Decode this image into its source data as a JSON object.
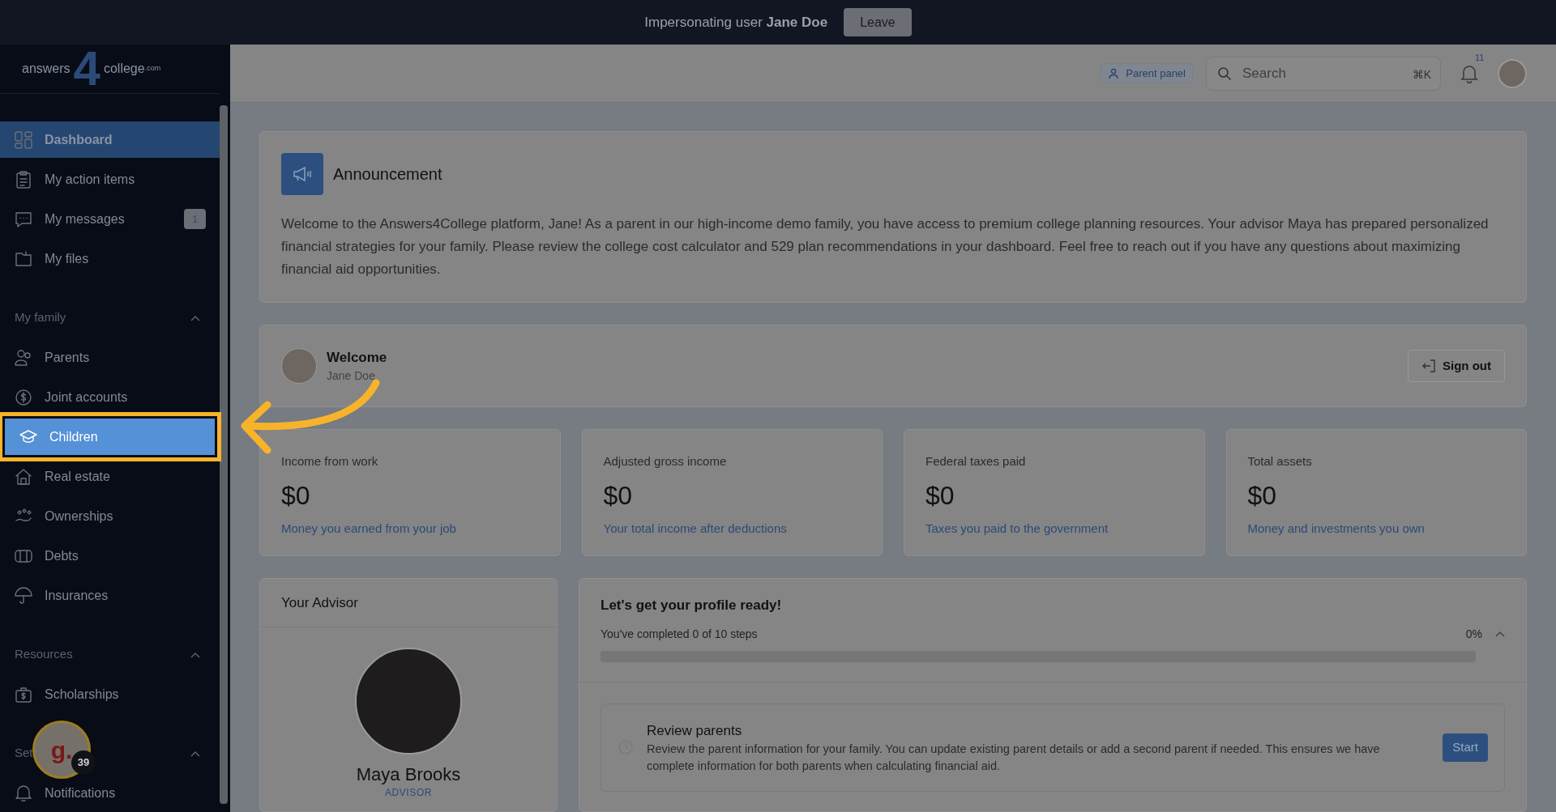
{
  "impersonation_bar": {
    "text": "Impersonating user **Jane Doe**",
    "button": "Leave"
  },
  "logo": {
    "left": "answers",
    "digit": "4",
    "right": "college",
    "suffix": ".com"
  },
  "header": {
    "parent_panel": "Parent panel",
    "search": {
      "placeholder": "Search",
      "shortcut": "⌘K"
    },
    "notifications": "11"
  },
  "sidebar": {
    "items": [
      {
        "label": "Dashboard",
        "selected": true
      },
      {
        "label": "My action items",
        "selected": false
      },
      {
        "label": "My messages",
        "selected": false,
        "badge": "1"
      },
      {
        "label": "My files",
        "selected": false
      }
    ],
    "sections": [
      {
        "title": "My family",
        "expanded": true,
        "items": [
          {
            "label": "Parents",
            "selected": false
          },
          {
            "label": "Joint accounts",
            "selected": false
          },
          {
            "label": "Children",
            "selected": false,
            "highlighted": true
          },
          {
            "label": "Real estate",
            "selected": false
          },
          {
            "label": "Ownerships",
            "selected": false
          },
          {
            "label": "Debts",
            "selected": false
          },
          {
            "label": "Insurances",
            "selected": false
          }
        ]
      },
      {
        "title": "Resources",
        "expanded": true,
        "items": [
          {
            "label": "Scholarships",
            "selected": false
          }
        ]
      },
      {
        "title": "Set",
        "expanded": true,
        "items": [
          {
            "label": "Notifications",
            "selected": false
          }
        ]
      }
    ]
  },
  "recorder_widget": {
    "logo": "g.",
    "count": "39"
  },
  "announcement": {
    "title": "Announcement",
    "body": "Welcome to the Answers4College platform, Jane! As a parent in our high-income demo family, you have access to premium college planning resources. Your advisor Maya has prepared personalized financial strategies for your family. Please review the college cost calculator and 529 plan recommendations in your dashboard. Feel free to reach out if you have any questions about maximizing financial aid opportunities."
  },
  "welcome": {
    "title": "Welcome",
    "name": "Jane Doe",
    "button": "Sign out"
  },
  "stats": [
    {
      "label": "Income from work",
      "value": "$0",
      "note": "Money you earned from your job"
    },
    {
      "label": "Adjusted gross income",
      "value": "$0",
      "note": "Your total income after deductions"
    },
    {
      "label": "Federal taxes paid",
      "value": "$0",
      "note": "Taxes you paid to the government"
    },
    {
      "label": "Total assets",
      "value": "$0",
      "note": "Money and investments you own"
    }
  ],
  "advisor": {
    "title": "Your Advisor",
    "name": "Maya Brooks",
    "role": "ADVISOR"
  },
  "profile": {
    "title": "Let's get your profile ready!",
    "progress_text": "You've completed 0 of 10 steps",
    "percent": "0%",
    "level": 0,
    "expanded": true,
    "steps": [
      {
        "title": "Review parents",
        "body": "Review the parent information for your family. You can update existing parent details or add a second parent if needed. This ensures we have complete information for both parents when calculating financial aid.",
        "button": "Start"
      }
    ]
  }
}
